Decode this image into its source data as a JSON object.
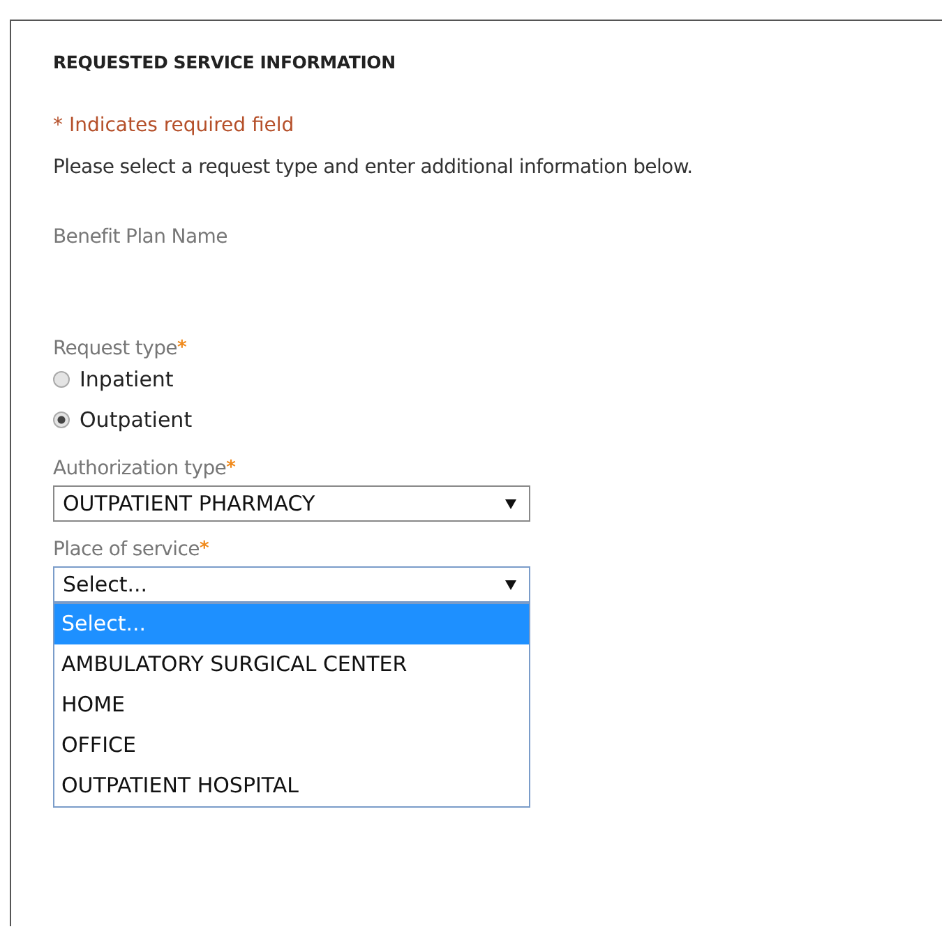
{
  "section_title": "REQUESTED SERVICE INFORMATION",
  "required_note": "* Indicates required field",
  "instructions": "Please select a request type and enter additional information below.",
  "benefit_plan": {
    "label": "Benefit Plan Name"
  },
  "request_type": {
    "label": "Request type",
    "required_mark": "*",
    "options": [
      {
        "label": "Inpatient",
        "selected": false
      },
      {
        "label": "Outpatient",
        "selected": true
      }
    ]
  },
  "authorization_type": {
    "label": "Authorization type",
    "required_mark": "*",
    "value": "OUTPATIENT PHARMACY",
    "expanded": false
  },
  "place_of_service": {
    "label": "Place of service",
    "required_mark": "*",
    "value": "Select...",
    "expanded": true,
    "options": [
      {
        "label": "Select...",
        "selected": true
      },
      {
        "label": "AMBULATORY SURGICAL CENTER",
        "selected": false
      },
      {
        "label": "HOME",
        "selected": false
      },
      {
        "label": "OFFICE",
        "selected": false
      },
      {
        "label": "OUTPATIENT HOSPITAL",
        "selected": false
      }
    ]
  }
}
